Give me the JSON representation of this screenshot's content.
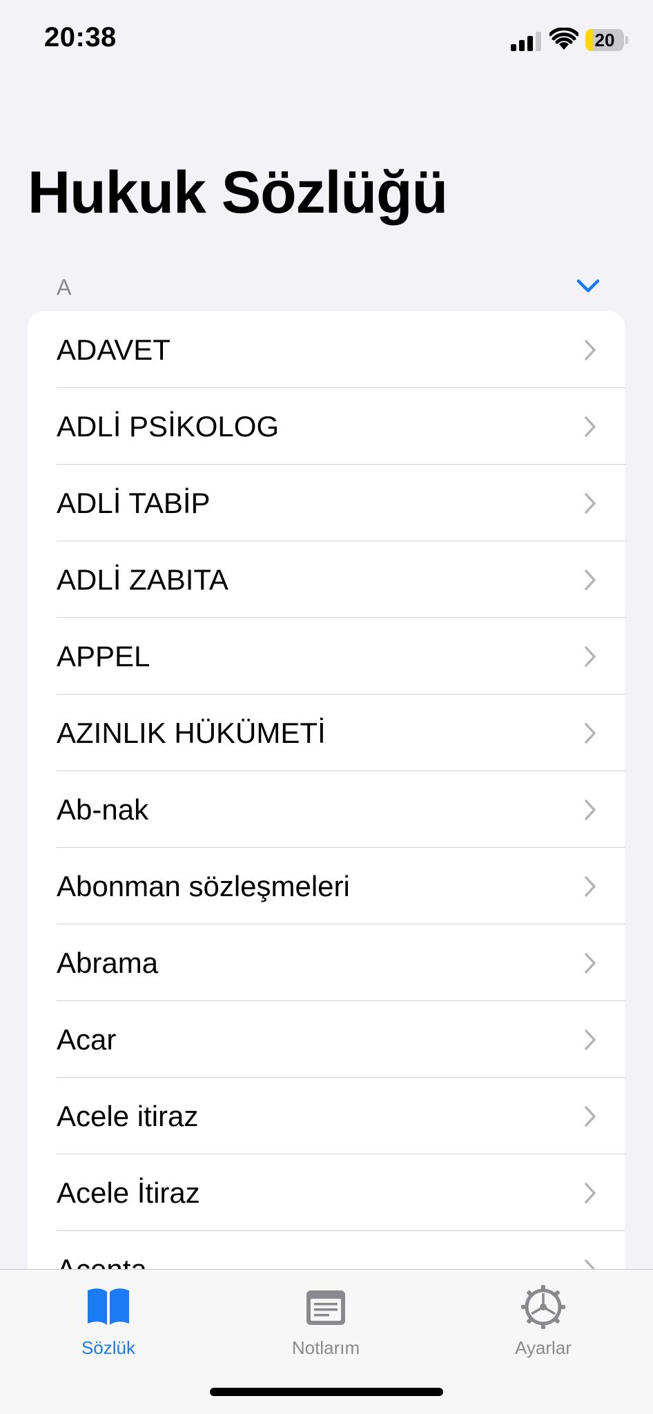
{
  "status_bar": {
    "time": "20:38",
    "battery_level": "20",
    "battery_color": "#ffd60a"
  },
  "title": "Hukuk Sözlüğü",
  "section": {
    "letter": "A",
    "collapse_icon": "chevron-down-icon"
  },
  "entries": [
    "ADAVET",
    "ADLİ PSİKOLOG",
    "ADLİ TABİP",
    "ADLİ ZABITA",
    "APPEL",
    "AZINLIK HÜKÜMETİ",
    "Ab-nak",
    "Abonman sözleşmeleri",
    "Abrama",
    "Acar",
    "Acele itiraz",
    "Acele İtiraz",
    "Acenta"
  ],
  "tab_bar": {
    "tabs": [
      {
        "label": "Sözlük",
        "icon": "book-icon",
        "active": true
      },
      {
        "label": "Notlarım",
        "icon": "notes-icon",
        "active": false
      },
      {
        "label": "Ayarlar",
        "icon": "gear-icon",
        "active": false
      }
    ],
    "accent_color": "#1a7cf5",
    "inactive_color": "#8a8a8e"
  }
}
